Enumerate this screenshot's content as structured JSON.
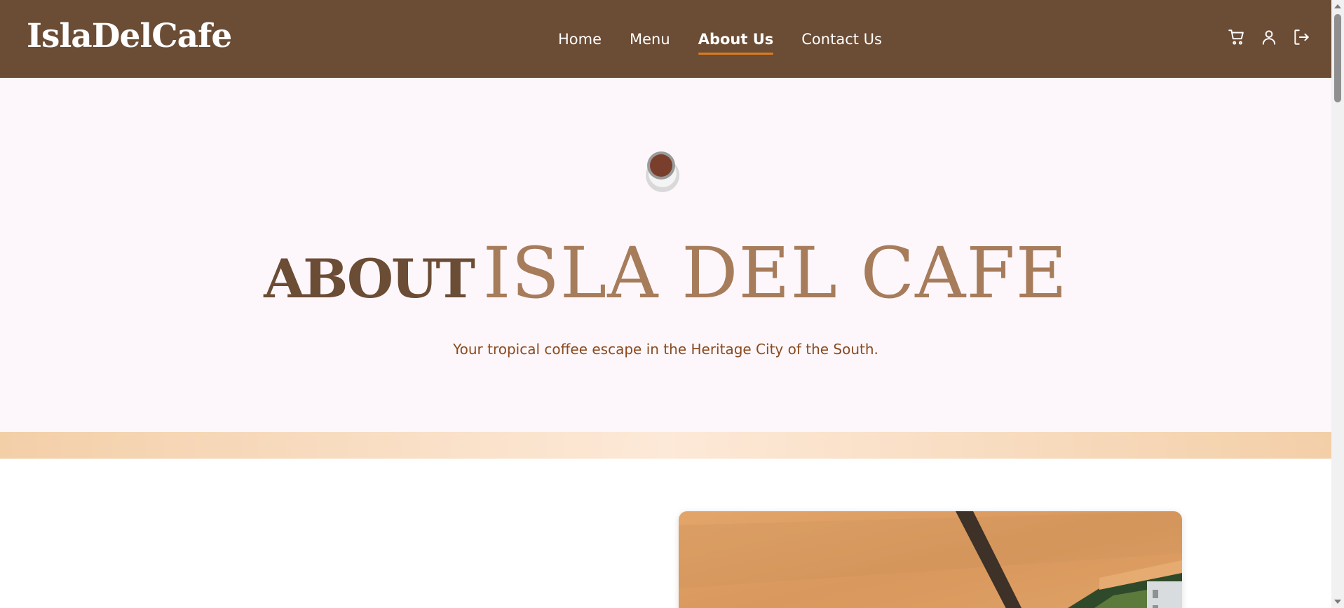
{
  "brand": {
    "name": "IslaDelCafe"
  },
  "nav": {
    "links": [
      {
        "label": "Home",
        "active": false
      },
      {
        "label": "Menu",
        "active": false
      },
      {
        "label": "About Us",
        "active": true
      },
      {
        "label": "Contact Us",
        "active": false
      }
    ],
    "icons": [
      "cart-icon",
      "user-icon",
      "logout-icon"
    ]
  },
  "hero": {
    "title_bold": "ABOUT",
    "title_light": "ISLA DEL CAFE",
    "subtitle": "Your tropical coffee escape in the Heritage City of the South.",
    "icon": "coffee-cup-icon"
  },
  "colors": {
    "navbar": "#6b4c35",
    "accent": "#e07a1f",
    "hero_bg": "#fdf7fb",
    "title_dark": "#6b4c35",
    "title_light": "#a67c5b",
    "subtitle": "#8a4a1e"
  }
}
